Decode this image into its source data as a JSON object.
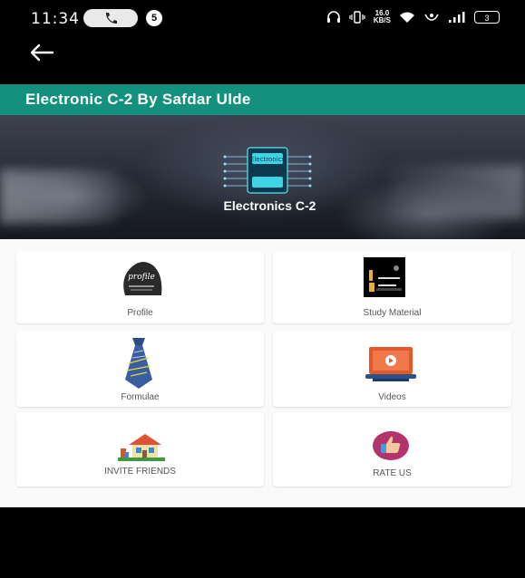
{
  "status_bar": {
    "time": "11:34",
    "notification_count": "5",
    "net_speed_value": "16.0",
    "net_speed_unit": "KB/S",
    "battery": "3"
  },
  "toolbar": {
    "title": "Electronic C-2 By Safdar Ulde"
  },
  "banner": {
    "title": "Electronics C-2",
    "logo_text": "Electronics"
  },
  "grid": {
    "items": [
      {
        "label": "Profile",
        "icon": "profile-icon",
        "icon_text": "profile"
      },
      {
        "label": "Study Material",
        "icon": "study-material-icon"
      },
      {
        "label": "Formulae",
        "icon": "tie-icon"
      },
      {
        "label": "Videos",
        "icon": "video-icon"
      },
      {
        "label": "INVITE FRIENDS",
        "icon": "house-icon"
      },
      {
        "label": "RATE US",
        "icon": "thumbs-up-icon"
      }
    ]
  },
  "colors": {
    "toolbar": "#14917e",
    "background": "#fafafa"
  }
}
